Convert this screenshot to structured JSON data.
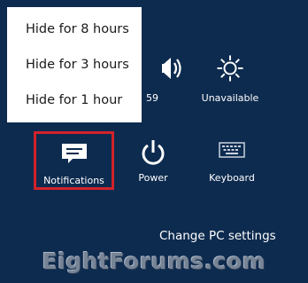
{
  "popup": {
    "items": [
      "Hide for 8 hours",
      "Hide for 3 hours",
      "Hide for 1 hour"
    ]
  },
  "tiles": {
    "volume": {
      "label": "59",
      "icon": "speaker-icon"
    },
    "network": {
      "label": "Unavailable",
      "icon": "brightness-icon"
    },
    "notifications": {
      "label": "Notifications",
      "icon": "notifications-icon"
    },
    "power": {
      "label": "Power",
      "icon": "power-icon"
    },
    "keyboard": {
      "label": "Keyboard",
      "icon": "keyboard-icon"
    }
  },
  "footer": {
    "change_pc_settings": "Change PC settings"
  },
  "watermark": "EightForums.com",
  "colors": {
    "background": "#0d2b4f",
    "highlight": "#d2232a",
    "popup": "#ffffff"
  }
}
